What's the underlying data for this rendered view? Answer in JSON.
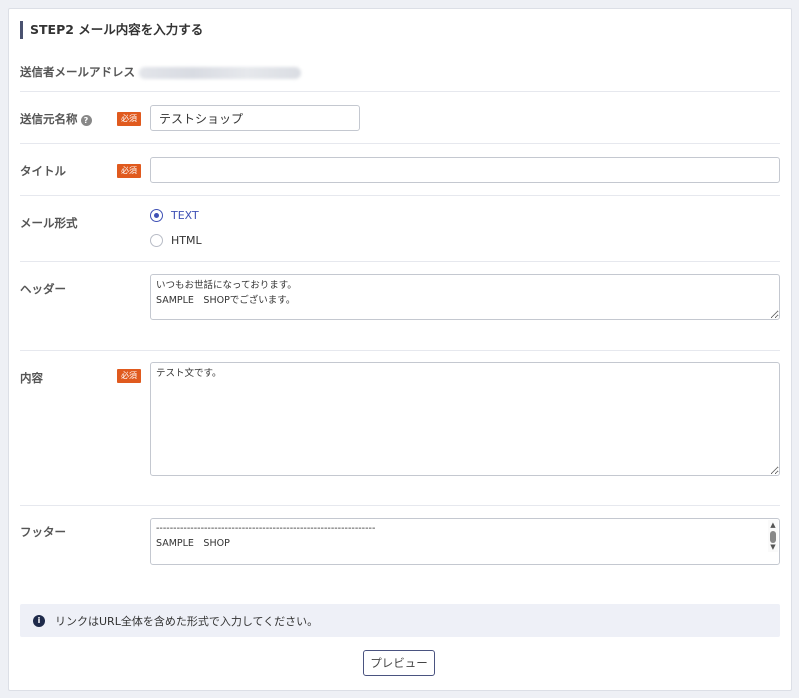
{
  "step_title": "STEP2 メール内容を入力する",
  "sender_email": {
    "label": "送信者メールアドレス"
  },
  "sender_name": {
    "label": "送信元名称",
    "help_icon": "?",
    "required": "必須",
    "value": "テストショップ"
  },
  "title": {
    "label": "タイトル",
    "required": "必須",
    "value": ""
  },
  "mail_format": {
    "label": "メール形式",
    "options": [
      {
        "label": "TEXT",
        "selected": true
      },
      {
        "label": "HTML",
        "selected": false
      }
    ]
  },
  "header": {
    "label": "ヘッダー",
    "value": "いつもお世話になっております。\nSAMPLE　SHOPでございます。"
  },
  "body": {
    "label": "内容",
    "required": "必須",
    "value": "テスト文です。"
  },
  "footer": {
    "label": "フッター",
    "value": "----------------------------------------------------------------\nSAMPLE　SHOP"
  },
  "notice": {
    "icon": "info-icon",
    "text": "リンクはURL全体を含めた形式で入力してください。"
  },
  "preview_button": "プレビュー",
  "colors": {
    "required_badge": "#e05a1e",
    "accent": "#3f51b5",
    "notice_bg": "#eef0f7"
  }
}
